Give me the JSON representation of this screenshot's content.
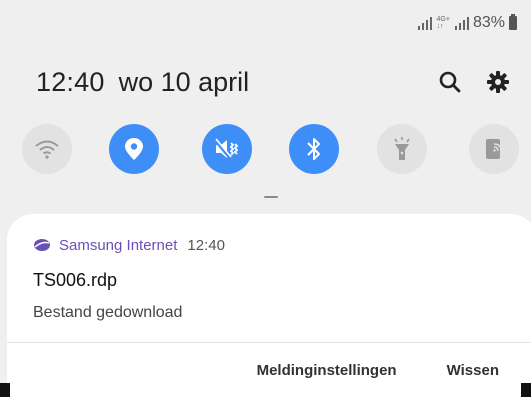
{
  "status_bar": {
    "network_type_top": "4G+",
    "network_type_bottom": "↓↑",
    "battery_percent": "83%"
  },
  "header": {
    "time": "12:40",
    "date": "wo 10 april",
    "icons": [
      "search-icon",
      "gear-icon"
    ]
  },
  "quick_toggles": [
    {
      "name": "wifi",
      "state": "off",
      "icon": "wifi-icon"
    },
    {
      "name": "location",
      "state": "on",
      "icon": "location-icon"
    },
    {
      "name": "sound",
      "state": "on",
      "icon": "vibrate-icon"
    },
    {
      "name": "bluetooth",
      "state": "on",
      "icon": "bluetooth-icon"
    },
    {
      "name": "flashlight",
      "state": "off",
      "icon": "flashlight-icon"
    },
    {
      "name": "screen-mirror",
      "state": "off",
      "icon": "cast-icon"
    }
  ],
  "notification": {
    "app_name": "Samsung Internet",
    "time": "12:40",
    "title": "TS006.rdp",
    "text": "Bestand gedownload",
    "actions": {
      "settings_label": "Meldinginstellingen",
      "clear_label": "Wissen"
    }
  },
  "colors": {
    "accent": "#3e8ef7",
    "toggle_off": "#e2e2e2",
    "app_purple": "#6a4fb8"
  }
}
